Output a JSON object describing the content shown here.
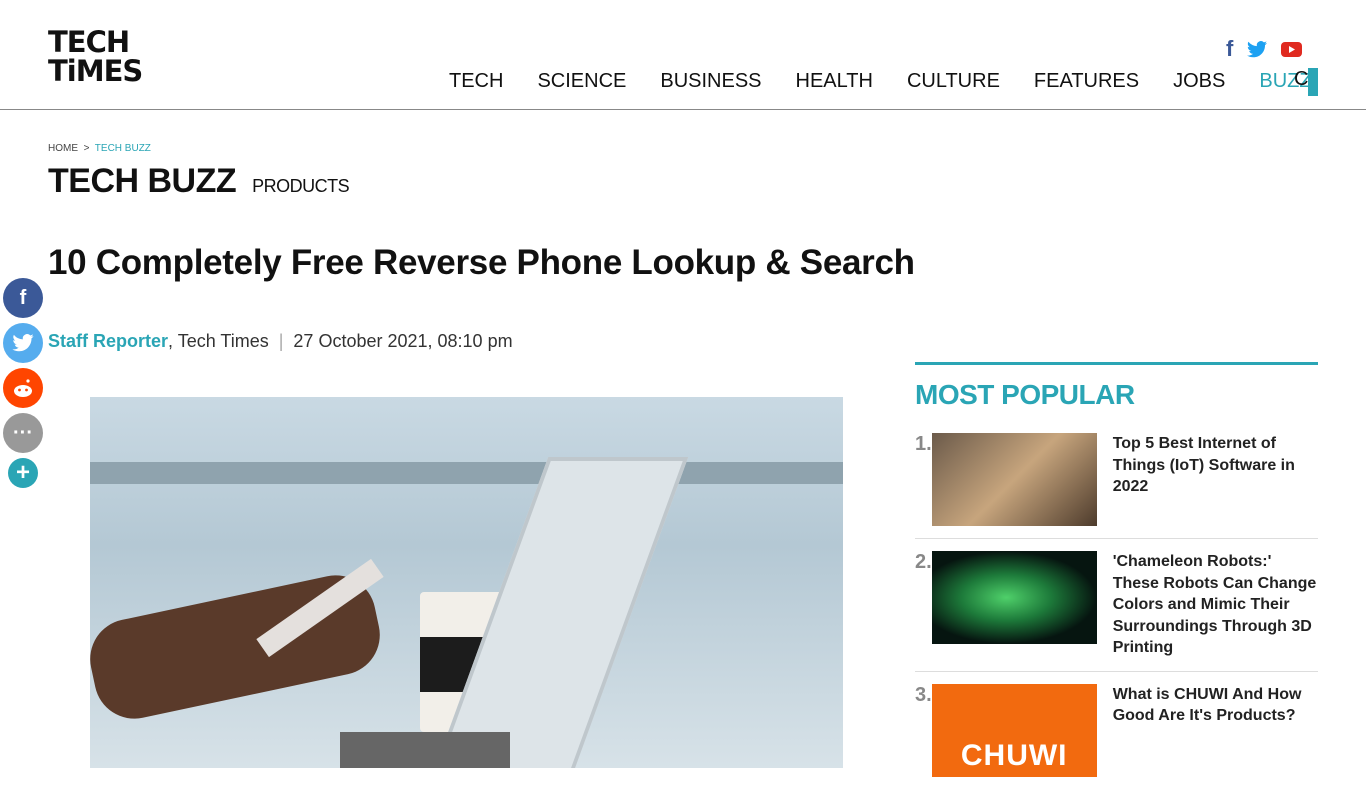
{
  "header": {
    "logo_line1": "TECH",
    "logo_line2": "TiMES",
    "nav": [
      "TECH",
      "SCIENCE",
      "BUSINESS",
      "HEALTH",
      "CULTURE",
      "FEATURES",
      "JOBS",
      "BUZZ"
    ],
    "active_nav": "BUZZ",
    "nav_overflow": "C",
    "social": [
      "facebook-icon",
      "twitter-icon",
      "youtube-icon"
    ]
  },
  "breadcrumb": {
    "home": "HOME",
    "sep": ">",
    "current": "TECH BUZZ"
  },
  "section": {
    "title": "TECH BUZZ",
    "sub": "PRODUCTS"
  },
  "article": {
    "title": "10 Completely Free Reverse Phone Lookup & Search",
    "author": "Staff Reporter",
    "publication": ", Tech Times",
    "date": "27 October 2021, 08:10 pm"
  },
  "share": {
    "comment_glyph": "···",
    "more_glyph": "+"
  },
  "sidebar": {
    "title": "MOST POPULAR",
    "items": [
      {
        "num": "1.",
        "title": "Top 5 Best Internet of Things (IoT) Software in 2022"
      },
      {
        "num": "2.",
        "title": "'Chameleon Robots:' These Robots Can Change Colors and Mimic Their Surroundings Through 3D Printing"
      },
      {
        "num": "3.",
        "title": "What is CHUWI And How Good Are It's Products?",
        "thumb_text": "CHUWI"
      }
    ]
  },
  "colors": {
    "accent": "#2aa5b5",
    "facebook": "#3b5998",
    "twitter": "#1da1f2",
    "youtube": "#e02a20",
    "reddit": "#ff4500"
  }
}
